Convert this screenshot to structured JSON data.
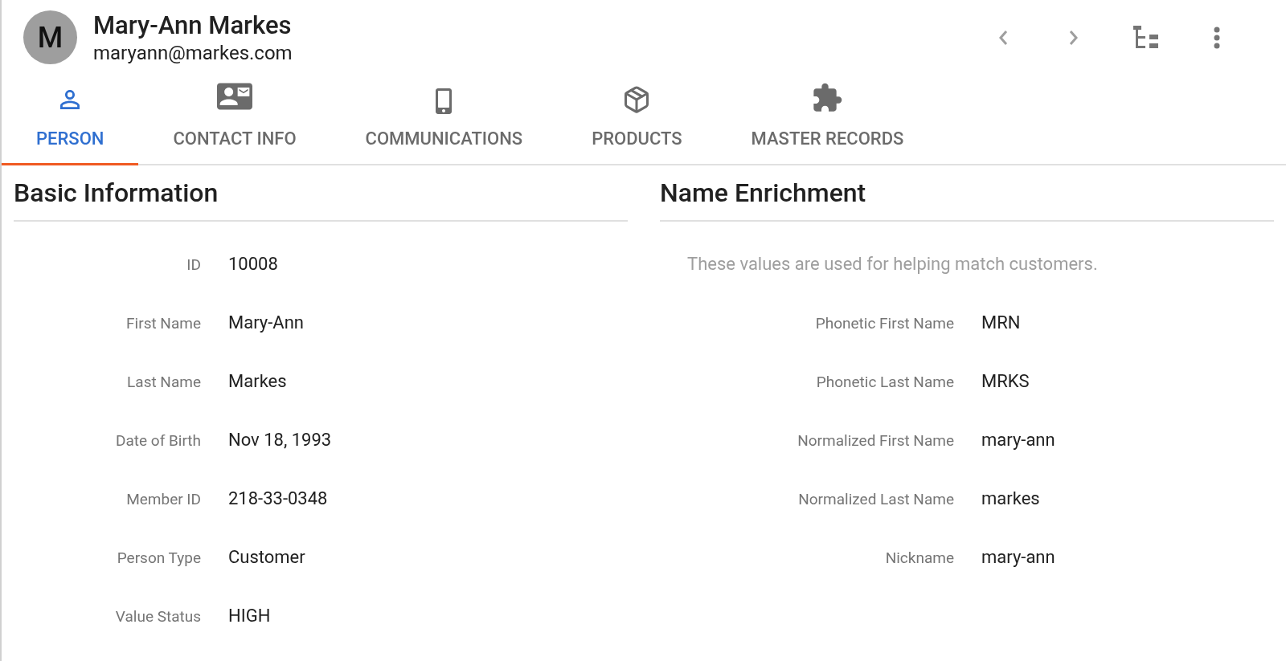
{
  "header": {
    "avatar_letter": "M",
    "name": "Mary-Ann Markes",
    "email": "maryann@markes.com"
  },
  "tabs": [
    {
      "label": "PERSON",
      "selected": true
    },
    {
      "label": "CONTACT INFO",
      "selected": false
    },
    {
      "label": "COMMUNICATIONS",
      "selected": false
    },
    {
      "label": "PRODUCTS",
      "selected": false
    },
    {
      "label": "MASTER RECORDS",
      "selected": false
    }
  ],
  "basic_information": {
    "title": "Basic Information",
    "fields": [
      {
        "label": "ID",
        "value": "10008"
      },
      {
        "label": "First Name",
        "value": "Mary-Ann"
      },
      {
        "label": "Last Name",
        "value": "Markes"
      },
      {
        "label": "Date of Birth",
        "value": "Nov 18, 1993"
      },
      {
        "label": "Member ID",
        "value": "218-33-0348"
      },
      {
        "label": "Person Type",
        "value": "Customer"
      },
      {
        "label": "Value Status",
        "value": "HIGH"
      }
    ]
  },
  "name_enrichment": {
    "title": "Name Enrichment",
    "description": "These values are used for helping match customers.",
    "fields": [
      {
        "label": "Phonetic First Name",
        "value": "MRN"
      },
      {
        "label": "Phonetic Last Name",
        "value": "MRKS"
      },
      {
        "label": "Normalized First Name",
        "value": "mary-ann"
      },
      {
        "label": "Normalized Last Name",
        "value": "markes"
      },
      {
        "label": "Nickname",
        "value": "mary-ann"
      }
    ]
  }
}
